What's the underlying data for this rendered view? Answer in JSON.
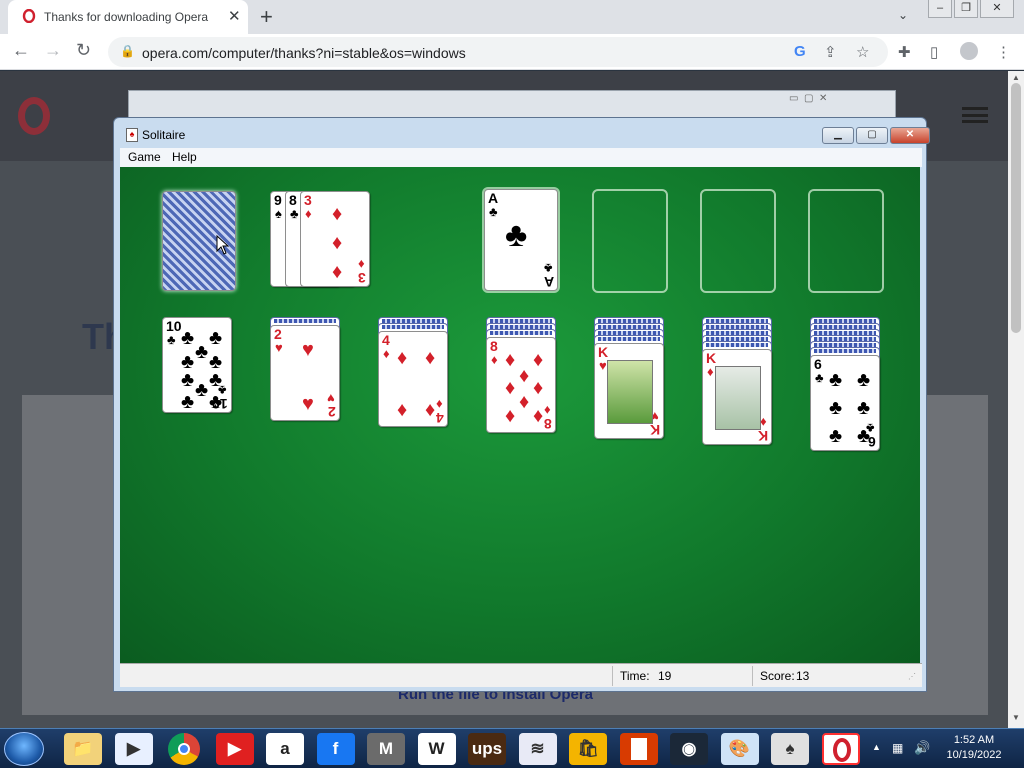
{
  "browser": {
    "tab_title": "Thanks for downloading Opera",
    "tab_close": "✕",
    "new_tab": "+",
    "url": "opera.com/computer/thanks?ni=stable&os=windows",
    "google_g": "G"
  },
  "page": {
    "title_fragment": "Th",
    "run_text": "Run the file to install Opera"
  },
  "solitaire": {
    "title": "Solitaire",
    "menu": [
      "Game",
      "Help"
    ],
    "status": {
      "time_label": "Time:",
      "time_value": "19",
      "score_label": "Score:",
      "score_value": "13"
    },
    "stock": {
      "face_down": true
    },
    "waste": [
      {
        "rank": "9",
        "suit": "♠",
        "color": "black"
      },
      {
        "rank": "8",
        "suit": "♣",
        "color": "black"
      },
      {
        "rank": "3",
        "suit": "♦",
        "color": "red"
      }
    ],
    "foundations": [
      {
        "rank": "A",
        "suit": "♣",
        "color": "black"
      },
      null,
      null,
      null
    ],
    "tableau": [
      {
        "hidden": 0,
        "top": {
          "rank": "10",
          "suit": "♣",
          "color": "black"
        }
      },
      {
        "hidden": 1,
        "top": {
          "rank": "2",
          "suit": "♥",
          "color": "red"
        }
      },
      {
        "hidden": 2,
        "top": {
          "rank": "4",
          "suit": "♦",
          "color": "red"
        }
      },
      {
        "hidden": 3,
        "top": {
          "rank": "8",
          "suit": "♦",
          "color": "red"
        }
      },
      {
        "hidden": 4,
        "top": {
          "rank": "K",
          "suit": "♥",
          "color": "red"
        }
      },
      {
        "hidden": 5,
        "top": {
          "rank": "K",
          "suit": "♦",
          "color": "red"
        }
      },
      {
        "hidden": 6,
        "top": {
          "rank": "6",
          "suit": "♣",
          "color": "black"
        }
      }
    ]
  },
  "taskbar": {
    "apps": [
      "folder-icon",
      "media-player-icon",
      "chrome-icon",
      "youtube-icon",
      "amazon-icon",
      "facebook-icon",
      "m-app-icon",
      "wikipedia-icon",
      "ups-icon",
      "bank-of-america-icon",
      "store-bag-icon",
      "office-icon",
      "steam-icon",
      "paint-icon",
      "solitaire-icon",
      "opera-icon"
    ],
    "amazon_letter": "a",
    "facebook_letter": "f",
    "m_letter": "M",
    "wiki_letter": "W",
    "ups_letter": "ups",
    "clock_time": "1:52 AM",
    "clock_date": "10/19/2022"
  }
}
